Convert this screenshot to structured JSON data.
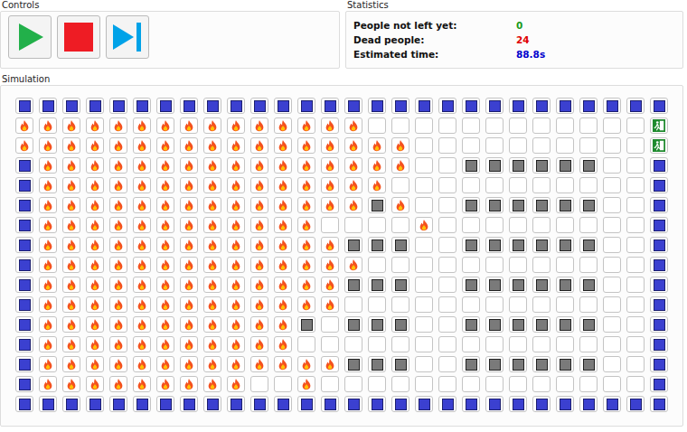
{
  "panels": {
    "controls": "Controls",
    "statistics": "Statistics",
    "simulation": "Simulation"
  },
  "controls": [
    {
      "kind": "play"
    },
    {
      "kind": "stop"
    },
    {
      "kind": "step"
    }
  ],
  "statistics": [
    {
      "label": "People not left yet:",
      "value": "0",
      "color": "#1a9a1a"
    },
    {
      "label": "Dead people:",
      "value": "24",
      "color": "#e00000"
    },
    {
      "label": "Estimated time:",
      "value": "88.8s",
      "color": "#0000cc"
    }
  ],
  "grid": [
    [
      "wall",
      "wall",
      "wall",
      "wall",
      "wall",
      "wall",
      "wall",
      "wall",
      "wall",
      "wall",
      "wall",
      "wall",
      "wall",
      "wall",
      "wall",
      "wall",
      "wall",
      "wall",
      "wall",
      "wall",
      "wall",
      "wall",
      "wall",
      "wall",
      "wall",
      "wall",
      "wall",
      "wall"
    ],
    [
      "fire",
      "fire",
      "fire",
      "fire",
      "fire",
      "fire",
      "fire",
      "fire",
      "fire",
      "fire",
      "fire",
      "fire",
      "fire",
      "fire",
      "fire",
      "empty",
      "empty",
      "empty",
      "empty",
      "empty",
      "empty",
      "empty",
      "empty",
      "empty",
      "empty",
      "empty",
      "empty",
      "exit"
    ],
    [
      "fire",
      "fire",
      "fire",
      "fire",
      "fire",
      "fire",
      "fire",
      "fire",
      "fire",
      "fire",
      "fire",
      "fire",
      "fire",
      "fire",
      "fire",
      "fire",
      "fire",
      "empty",
      "empty",
      "empty",
      "empty",
      "empty",
      "empty",
      "empty",
      "empty",
      "empty",
      "empty",
      "exit"
    ],
    [
      "wall",
      "fire",
      "fire",
      "fire",
      "fire",
      "fire",
      "fire",
      "fire",
      "fire",
      "fire",
      "fire",
      "fire",
      "fire",
      "fire",
      "fire",
      "fire",
      "fire",
      "empty",
      "empty",
      "obstacle",
      "obstacle",
      "obstacle",
      "obstacle",
      "obstacle",
      "obstacle",
      "empty",
      "empty",
      "wall"
    ],
    [
      "wall",
      "fire",
      "fire",
      "fire",
      "fire",
      "fire",
      "fire",
      "fire",
      "fire",
      "fire",
      "fire",
      "fire",
      "fire",
      "fire",
      "fire",
      "fire",
      "empty",
      "empty",
      "empty",
      "empty",
      "empty",
      "empty",
      "empty",
      "empty",
      "empty",
      "empty",
      "empty",
      "wall"
    ],
    [
      "wall",
      "fire",
      "fire",
      "fire",
      "fire",
      "fire",
      "fire",
      "fire",
      "fire",
      "fire",
      "fire",
      "fire",
      "fire",
      "fire",
      "fire",
      "obstacle",
      "fire",
      "empty",
      "empty",
      "obstacle",
      "obstacle",
      "obstacle",
      "obstacle",
      "obstacle",
      "obstacle",
      "empty",
      "empty",
      "wall"
    ],
    [
      "wall",
      "fire",
      "fire",
      "fire",
      "fire",
      "fire",
      "fire",
      "fire",
      "fire",
      "fire",
      "fire",
      "fire",
      "fire",
      "empty",
      "empty",
      "empty",
      "empty",
      "fire",
      "empty",
      "empty",
      "empty",
      "empty",
      "empty",
      "empty",
      "empty",
      "empty",
      "empty",
      "wall"
    ],
    [
      "wall",
      "fire",
      "fire",
      "fire",
      "fire",
      "fire",
      "fire",
      "fire",
      "fire",
      "fire",
      "fire",
      "fire",
      "fire",
      "fire",
      "obstacle",
      "obstacle",
      "obstacle",
      "empty",
      "empty",
      "obstacle",
      "obstacle",
      "obstacle",
      "obstacle",
      "obstacle",
      "obstacle",
      "empty",
      "empty",
      "wall"
    ],
    [
      "wall",
      "fire",
      "fire",
      "fire",
      "fire",
      "fire",
      "fire",
      "fire",
      "fire",
      "fire",
      "fire",
      "fire",
      "fire",
      "fire",
      "fire",
      "empty",
      "empty",
      "empty",
      "empty",
      "empty",
      "empty",
      "empty",
      "empty",
      "empty",
      "empty",
      "empty",
      "empty",
      "wall"
    ],
    [
      "wall",
      "fire",
      "fire",
      "fire",
      "fire",
      "fire",
      "fire",
      "fire",
      "fire",
      "fire",
      "fire",
      "fire",
      "fire",
      "fire",
      "obstacle",
      "obstacle",
      "obstacle",
      "empty",
      "empty",
      "obstacle",
      "obstacle",
      "obstacle",
      "obstacle",
      "obstacle",
      "obstacle",
      "empty",
      "empty",
      "wall"
    ],
    [
      "wall",
      "fire",
      "fire",
      "fire",
      "fire",
      "fire",
      "fire",
      "fire",
      "fire",
      "fire",
      "fire",
      "fire",
      "fire",
      "fire",
      "empty",
      "empty",
      "empty",
      "empty",
      "empty",
      "empty",
      "empty",
      "empty",
      "empty",
      "empty",
      "empty",
      "empty",
      "empty",
      "wall"
    ],
    [
      "wall",
      "fire",
      "fire",
      "fire",
      "fire",
      "fire",
      "fire",
      "fire",
      "fire",
      "fire",
      "fire",
      "fire",
      "obstacle",
      "empty",
      "obstacle",
      "obstacle",
      "obstacle",
      "empty",
      "empty",
      "obstacle",
      "obstacle",
      "obstacle",
      "obstacle",
      "obstacle",
      "obstacle",
      "empty",
      "empty",
      "wall"
    ],
    [
      "wall",
      "fire",
      "fire",
      "fire",
      "fire",
      "fire",
      "fire",
      "fire",
      "fire",
      "fire",
      "fire",
      "fire",
      "empty",
      "empty",
      "empty",
      "empty",
      "empty",
      "empty",
      "empty",
      "empty",
      "empty",
      "empty",
      "empty",
      "empty",
      "empty",
      "empty",
      "empty",
      "wall"
    ],
    [
      "wall",
      "fire",
      "fire",
      "fire",
      "fire",
      "fire",
      "fire",
      "fire",
      "fire",
      "fire",
      "fire",
      "fire",
      "fire",
      "fire",
      "obstacle",
      "obstacle",
      "obstacle",
      "empty",
      "empty",
      "obstacle",
      "obstacle",
      "obstacle",
      "obstacle",
      "obstacle",
      "obstacle",
      "empty",
      "empty",
      "wall"
    ],
    [
      "wall",
      "fire",
      "fire",
      "fire",
      "fire",
      "fire",
      "fire",
      "fire",
      "fire",
      "fire",
      "empty",
      "empty",
      "fire",
      "empty",
      "empty",
      "empty",
      "empty",
      "empty",
      "empty",
      "empty",
      "empty",
      "empty",
      "empty",
      "empty",
      "empty",
      "empty",
      "empty",
      "wall"
    ],
    [
      "wall",
      "wall",
      "wall",
      "wall",
      "wall",
      "wall",
      "wall",
      "wall",
      "wall",
      "wall",
      "wall",
      "wall",
      "wall",
      "wall",
      "wall",
      "wall",
      "wall",
      "wall",
      "wall",
      "wall",
      "wall",
      "wall",
      "wall",
      "wall",
      "wall",
      "wall",
      "wall",
      "wall"
    ]
  ]
}
